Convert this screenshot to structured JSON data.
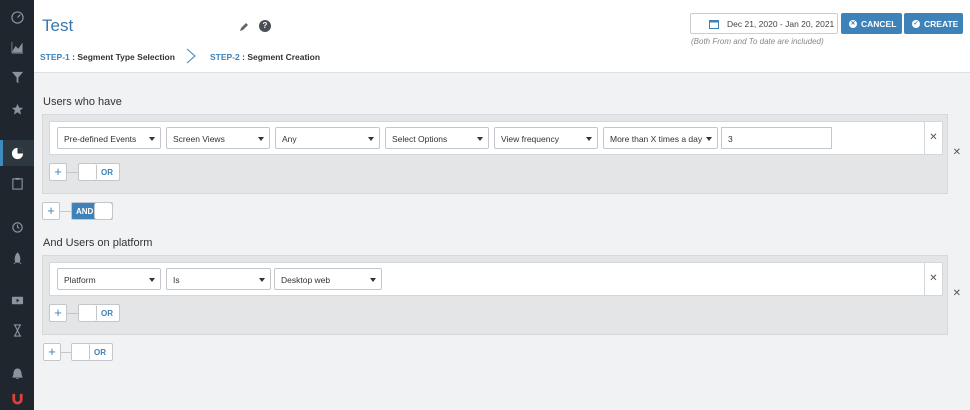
{
  "sidebar": {
    "icons": [
      "dashboard-icon",
      "chart-icon",
      "funnel-icon",
      "star-icon",
      "pie-chart-icon",
      "clipboard-icon",
      "alarm-icon",
      "rocket-icon",
      "video-icon",
      "hourglass-icon",
      "bell-icon",
      "magnet-icon"
    ]
  },
  "header": {
    "title": "Test",
    "date_range": "Dec 21, 2020 - Jan 20, 2021",
    "date_note": "(Both From and To date are included)",
    "cancel_label": "CANCEL",
    "create_label": "CREATE",
    "steps": [
      {
        "num": "STEP-1",
        "label": " : Segment Type Selection"
      },
      {
        "num": "STEP-2",
        "label": " : Segment Creation"
      }
    ]
  },
  "users_who_have": {
    "title": "Users who have",
    "condition": {
      "event_type": "Pre-defined Events",
      "event": "Screen Views",
      "screen": "Any",
      "options_placeholder": "Select Options",
      "metric": "View frequency",
      "operator": "More than X times a day",
      "value": "3"
    },
    "or_label": "OR",
    "and_label": "AND"
  },
  "users_on_platform": {
    "title": "And Users on platform",
    "condition": {
      "field": "Platform",
      "operator": "Is",
      "value": "Desktop web"
    },
    "or_label": "OR",
    "outer_or_label": "OR"
  },
  "colors": {
    "accent": "#3d82b8",
    "sidebar": "#1f262d",
    "title": "#3978ad"
  }
}
